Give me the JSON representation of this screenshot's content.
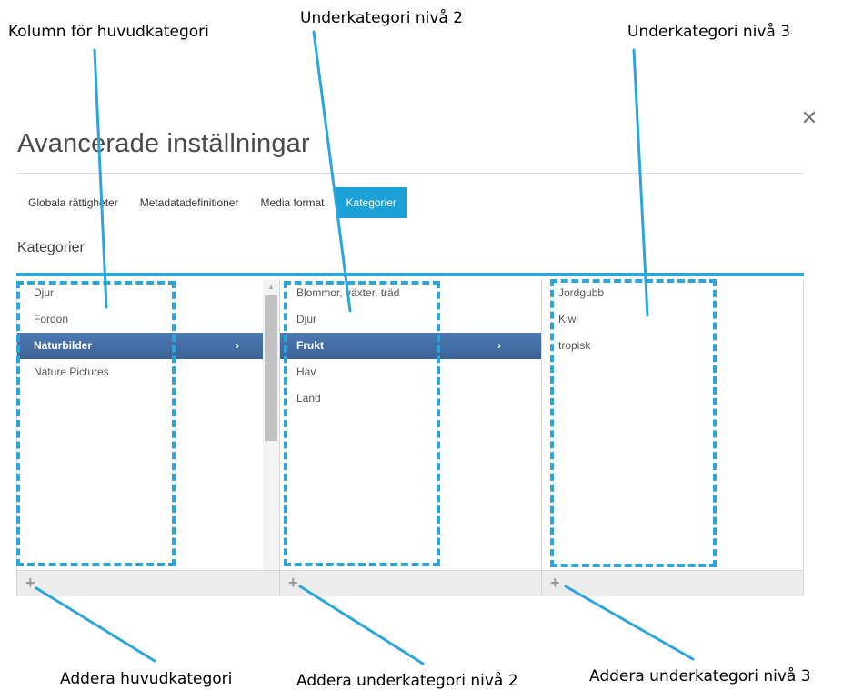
{
  "annotations": {
    "main_column": "Kolumn för huvudkategori",
    "level2": "Underkategori nivå 2",
    "level3": "Underkategori nivå 3",
    "add_main": "Addera huvudkategori",
    "add_level2": "Addera underkategori nivå 2",
    "add_level3": "Addera underkategori nivå 3"
  },
  "dialog": {
    "title": "Avancerade inställningar",
    "close_icon": "close-icon",
    "tabs": [
      {
        "label": "Globala rättigheter",
        "active": false
      },
      {
        "label": "Metadatadefinitioner",
        "active": false
      },
      {
        "label": "Media format",
        "active": false
      },
      {
        "label": "Kategorier",
        "active": true
      }
    ],
    "section_title": "Kategorier"
  },
  "columns": {
    "main": {
      "items": [
        "Djur",
        "Fordon",
        "Naturbilder",
        "Nature Pictures"
      ],
      "selected": "Naturbilder",
      "add_icon": "plus-icon"
    },
    "level2": {
      "items": [
        "Blommor, växter, träd",
        "Djur",
        "Frukt",
        "Hav",
        "Land"
      ],
      "selected": "Frukt",
      "add_icon": "plus-icon"
    },
    "level3": {
      "items": [
        "Jordgubb",
        "Kiwi",
        "tropisk"
      ],
      "add_icon": "plus-icon"
    }
  },
  "colors": {
    "accent": "#1ba1d6",
    "annotation_blue": "#2aa6dc",
    "selected_row": "#4470a8"
  },
  "chevron_icon": "chevron-right-icon"
}
